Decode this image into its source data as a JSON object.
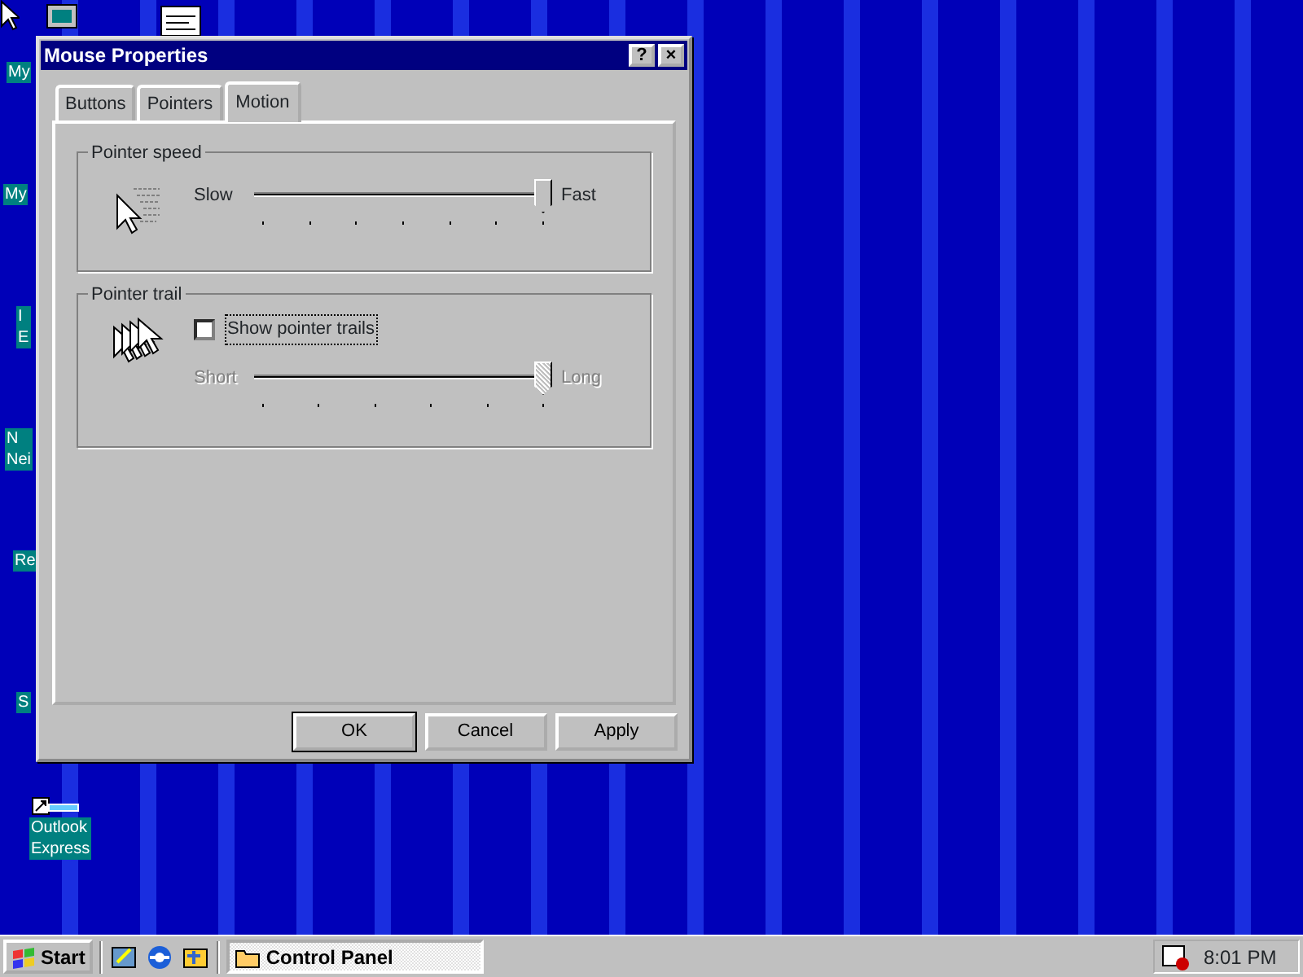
{
  "desktop_icons": [
    {
      "lines": [
        "My"
      ]
    },
    {
      "lines": [
        "My"
      ]
    },
    {
      "lines": [
        "I",
        "E"
      ]
    },
    {
      "lines": [
        "N",
        "Nei"
      ]
    },
    {
      "lines": [
        "Re"
      ]
    },
    {
      "lines": [
        "S"
      ]
    },
    {
      "lines": [
        "Outlook",
        "Express"
      ]
    }
  ],
  "window": {
    "title": "Mouse Properties",
    "title_buttons": [
      "?",
      "×"
    ]
  },
  "tabs": [
    {
      "label": "Buttons",
      "selected": false
    },
    {
      "label": "Pointers",
      "selected": false
    },
    {
      "label": "Motion",
      "selected": true
    }
  ],
  "groups": [
    {
      "title": "Pointer speed",
      "slider": {
        "min_label": "Slow",
        "max_label": "Fast",
        "level": 1.0,
        "disabled": false
      }
    },
    {
      "title": "Pointer trail",
      "checkbox": {
        "label": "Show pointer trails",
        "checked": false,
        "focused": true
      },
      "slider": {
        "min_label": "Short",
        "max_label": "Long",
        "level": 1.0,
        "disabled": true
      }
    }
  ],
  "buttons": [
    {
      "label": "OK",
      "default": true
    },
    {
      "label": "Cancel",
      "default": false
    },
    {
      "label": "Apply",
      "default": false
    }
  ],
  "taskbar": {
    "start": "Start",
    "tasks": [
      {
        "label": "Control Panel",
        "selected": true
      }
    ],
    "clock": "8:01 PM"
  }
}
